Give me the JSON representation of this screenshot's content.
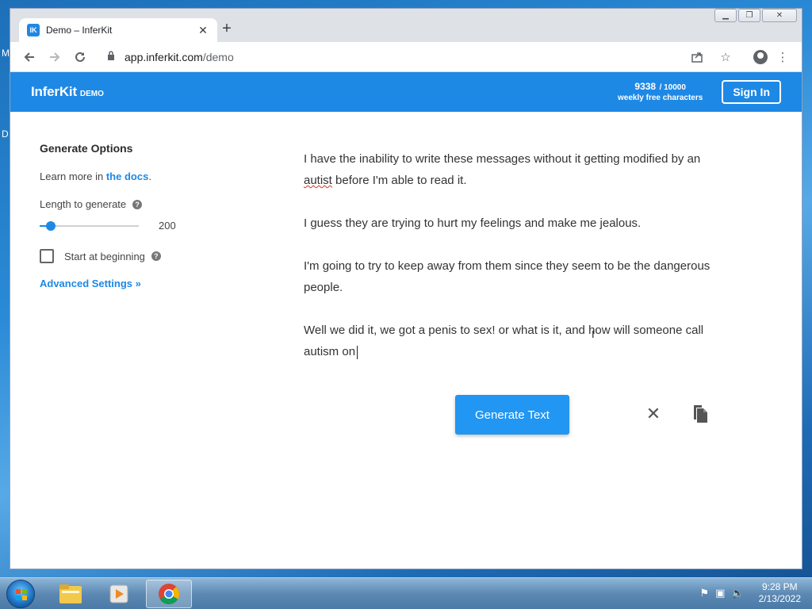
{
  "browser": {
    "tab_title": "Demo – InferKit",
    "tab_favicon": "IK",
    "url_host": "app.inferkit.com",
    "url_path": "/demo"
  },
  "app": {
    "logo": "InferKit",
    "logo_sub": "DEMO",
    "chars_used": "9338",
    "chars_total": "/ 10000",
    "chars_label": "weekly free characters",
    "sign_in": "Sign In"
  },
  "options": {
    "title": "Generate Options",
    "learn_more": "Learn more in",
    "docs_link": "the docs",
    "docs_suffix": ".",
    "length_label": "Length to generate",
    "length_value": "200",
    "length_fraction": 0.11,
    "start_label": "Start at beginning",
    "start_checked": false,
    "advanced": "Advanced Settings »"
  },
  "editor": {
    "p1_before": "I have the inability to write these messages without it getting modified by an ",
    "p1_spell": "autist",
    "p1_after": " before I'm able to read it.",
    "p2": "I guess they are trying to hurt my feelings and make me jealous.",
    "p3": "I'm going to try to keep away from them since they seem to be the dangerous people.",
    "p4": "Well we did it, we got a penis to sex! or what is it, and how will someone call autism on"
  },
  "actions": {
    "generate": "Generate Text",
    "clear_icon": "close-icon",
    "copy_icon": "copy-icon"
  },
  "taskbar": {
    "time": "9:28 PM",
    "date": "2/13/2022"
  },
  "colors": {
    "brand": "#1e88e5",
    "button": "#2196f3"
  }
}
